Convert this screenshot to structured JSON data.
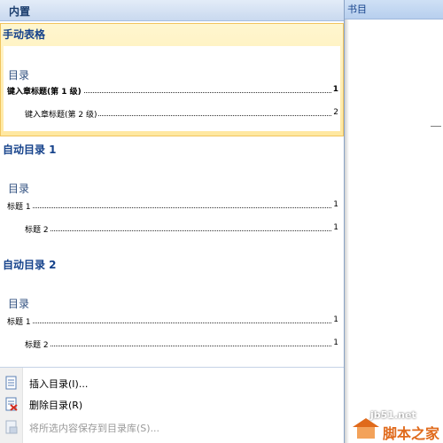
{
  "background": {
    "ribbon_tab": "书目"
  },
  "gallery": {
    "header": "内置",
    "sections": [
      {
        "title": "手动表格",
        "selected": true,
        "toc_heading": "目录",
        "lines": [
          {
            "label": "键入章标题(第 1 级)",
            "page": "1",
            "bold": true
          },
          {
            "label": "键入章标题(第 2 级)",
            "page": "2",
            "bold": false
          }
        ]
      },
      {
        "title": "自动目录 1",
        "selected": false,
        "toc_heading": "目录",
        "lines": [
          {
            "label": "标题 1",
            "page": "1",
            "bold": false
          },
          {
            "label": "标题 2",
            "page": "1",
            "bold": false
          }
        ]
      },
      {
        "title": "自动目录 2",
        "selected": false,
        "toc_heading": "目录",
        "lines": [
          {
            "label": "标题 1",
            "page": "1",
            "bold": false
          },
          {
            "label": "标题 2",
            "page": "1",
            "bold": false
          }
        ]
      }
    ]
  },
  "menu": {
    "items": [
      {
        "label": "插入目录(I)...",
        "disabled": false,
        "icon": "insert-toc-icon"
      },
      {
        "label": "删除目录(R)",
        "disabled": false,
        "icon": "remove-toc-icon"
      },
      {
        "label": "将所选内容保存到目录库(S)...",
        "disabled": true,
        "icon": "save-to-gallery-icon"
      }
    ]
  },
  "watermark": {
    "url": "jb51.net",
    "brand": "脚本之家"
  },
  "colors": {
    "accent": "#15428b",
    "hover": "#ffe8a0",
    "disabled": "#9a9a9a",
    "brand": "#e06a1b"
  }
}
